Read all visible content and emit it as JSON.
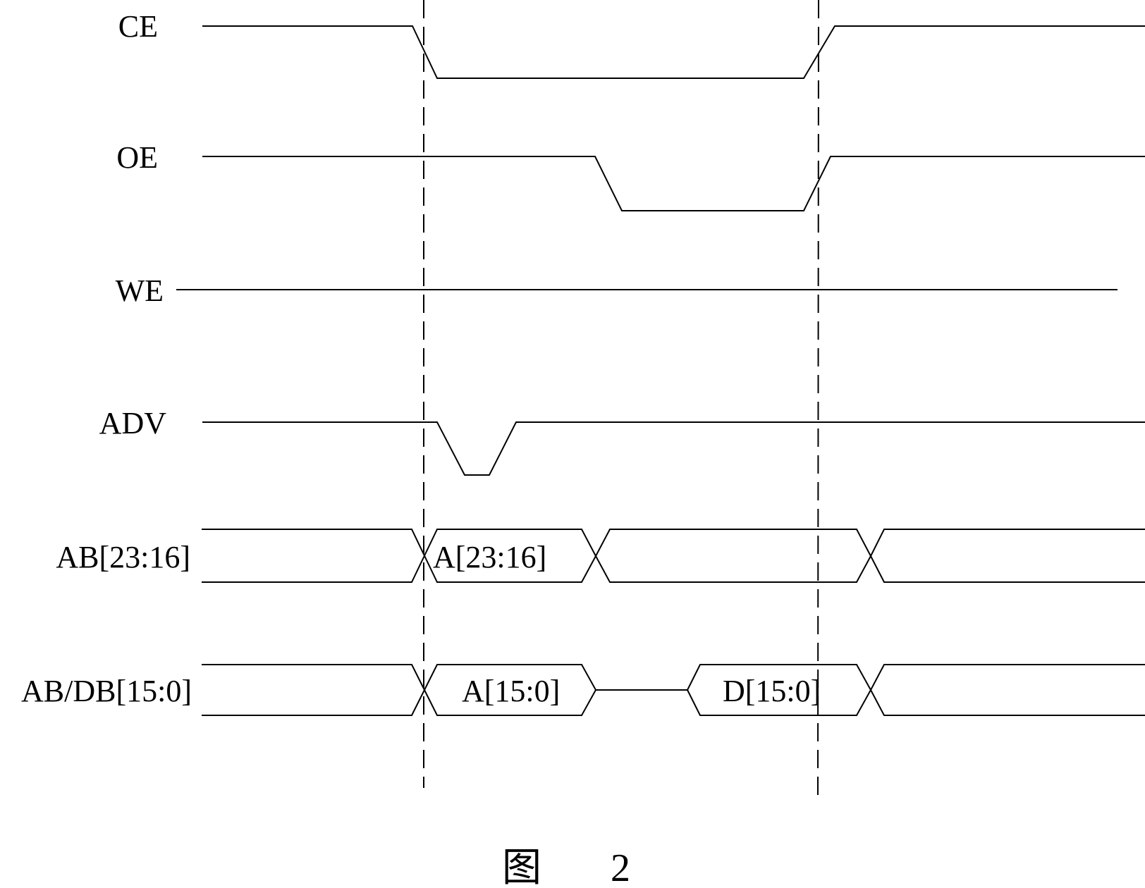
{
  "figure": {
    "caption_char": "图",
    "caption_num": "2"
  },
  "signals": [
    {
      "name": "CE"
    },
    {
      "name": "OE"
    },
    {
      "name": "WE"
    },
    {
      "name": "ADV"
    },
    {
      "name": "AB[23:16]",
      "segments": [
        "A[23:16]"
      ]
    },
    {
      "name": "AB/DB[15:0]",
      "segments": [
        "A[15:0]",
        "D[15:0]"
      ]
    }
  ],
  "timing": {
    "markers": 2,
    "CE": {
      "states": [
        "high",
        "low",
        "high"
      ]
    },
    "OE": {
      "states": [
        "high",
        "low",
        "high"
      ]
    },
    "WE": {
      "states": [
        "high"
      ]
    },
    "ADV": {
      "states": [
        "high",
        "low",
        "high"
      ]
    },
    "AB_23_16": {
      "states": [
        "invalid",
        "A[23:16]",
        "invalid",
        "invalid"
      ]
    },
    "AB_DB_15_0": {
      "states": [
        "invalid",
        "A[15:0]",
        "high-z",
        "D[15:0]",
        "invalid"
      ]
    }
  },
  "colors": {
    "line": "#000000",
    "background": "#ffffff"
  }
}
